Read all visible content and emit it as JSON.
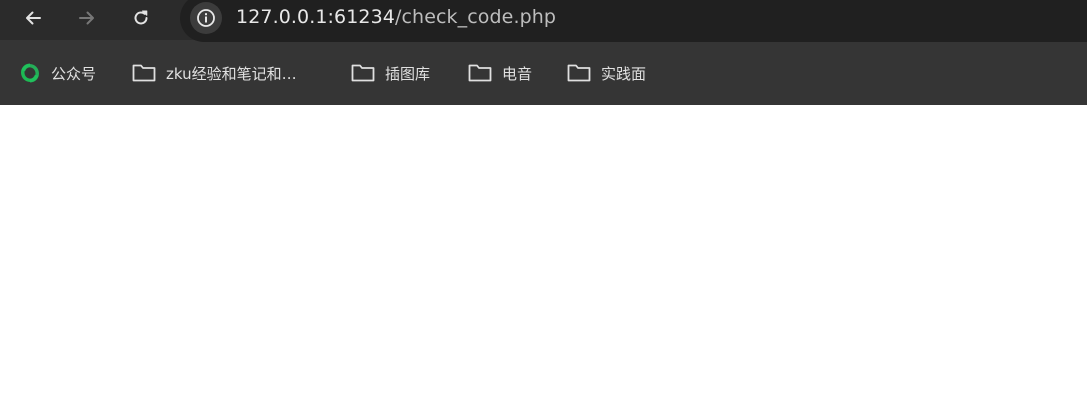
{
  "toolbar": {
    "back_icon": "arrow-left-icon",
    "forward_icon": "arrow-right-icon",
    "reload_icon": "reload-icon",
    "site_info_icon": "info-circle-icon",
    "url_host": "127.0.0.1:61234",
    "url_path": "/check_code.php"
  },
  "bookmarks": [
    {
      "label": "公众号",
      "icon": "green-swirl-logo-icon"
    },
    {
      "label": "zku经验和笔记和…",
      "icon": "folder-icon"
    },
    {
      "label": "插图库",
      "icon": "folder-icon"
    },
    {
      "label": "电音",
      "icon": "folder-icon"
    },
    {
      "label": "实践面",
      "icon": "folder-icon"
    }
  ],
  "colors": {
    "toolbar_bg": "#2b2b2b",
    "bookmarks_bg": "#353535",
    "omnibox_bg": "#202020",
    "page_bg": "#ffffff",
    "logo_green": "#1db954"
  }
}
